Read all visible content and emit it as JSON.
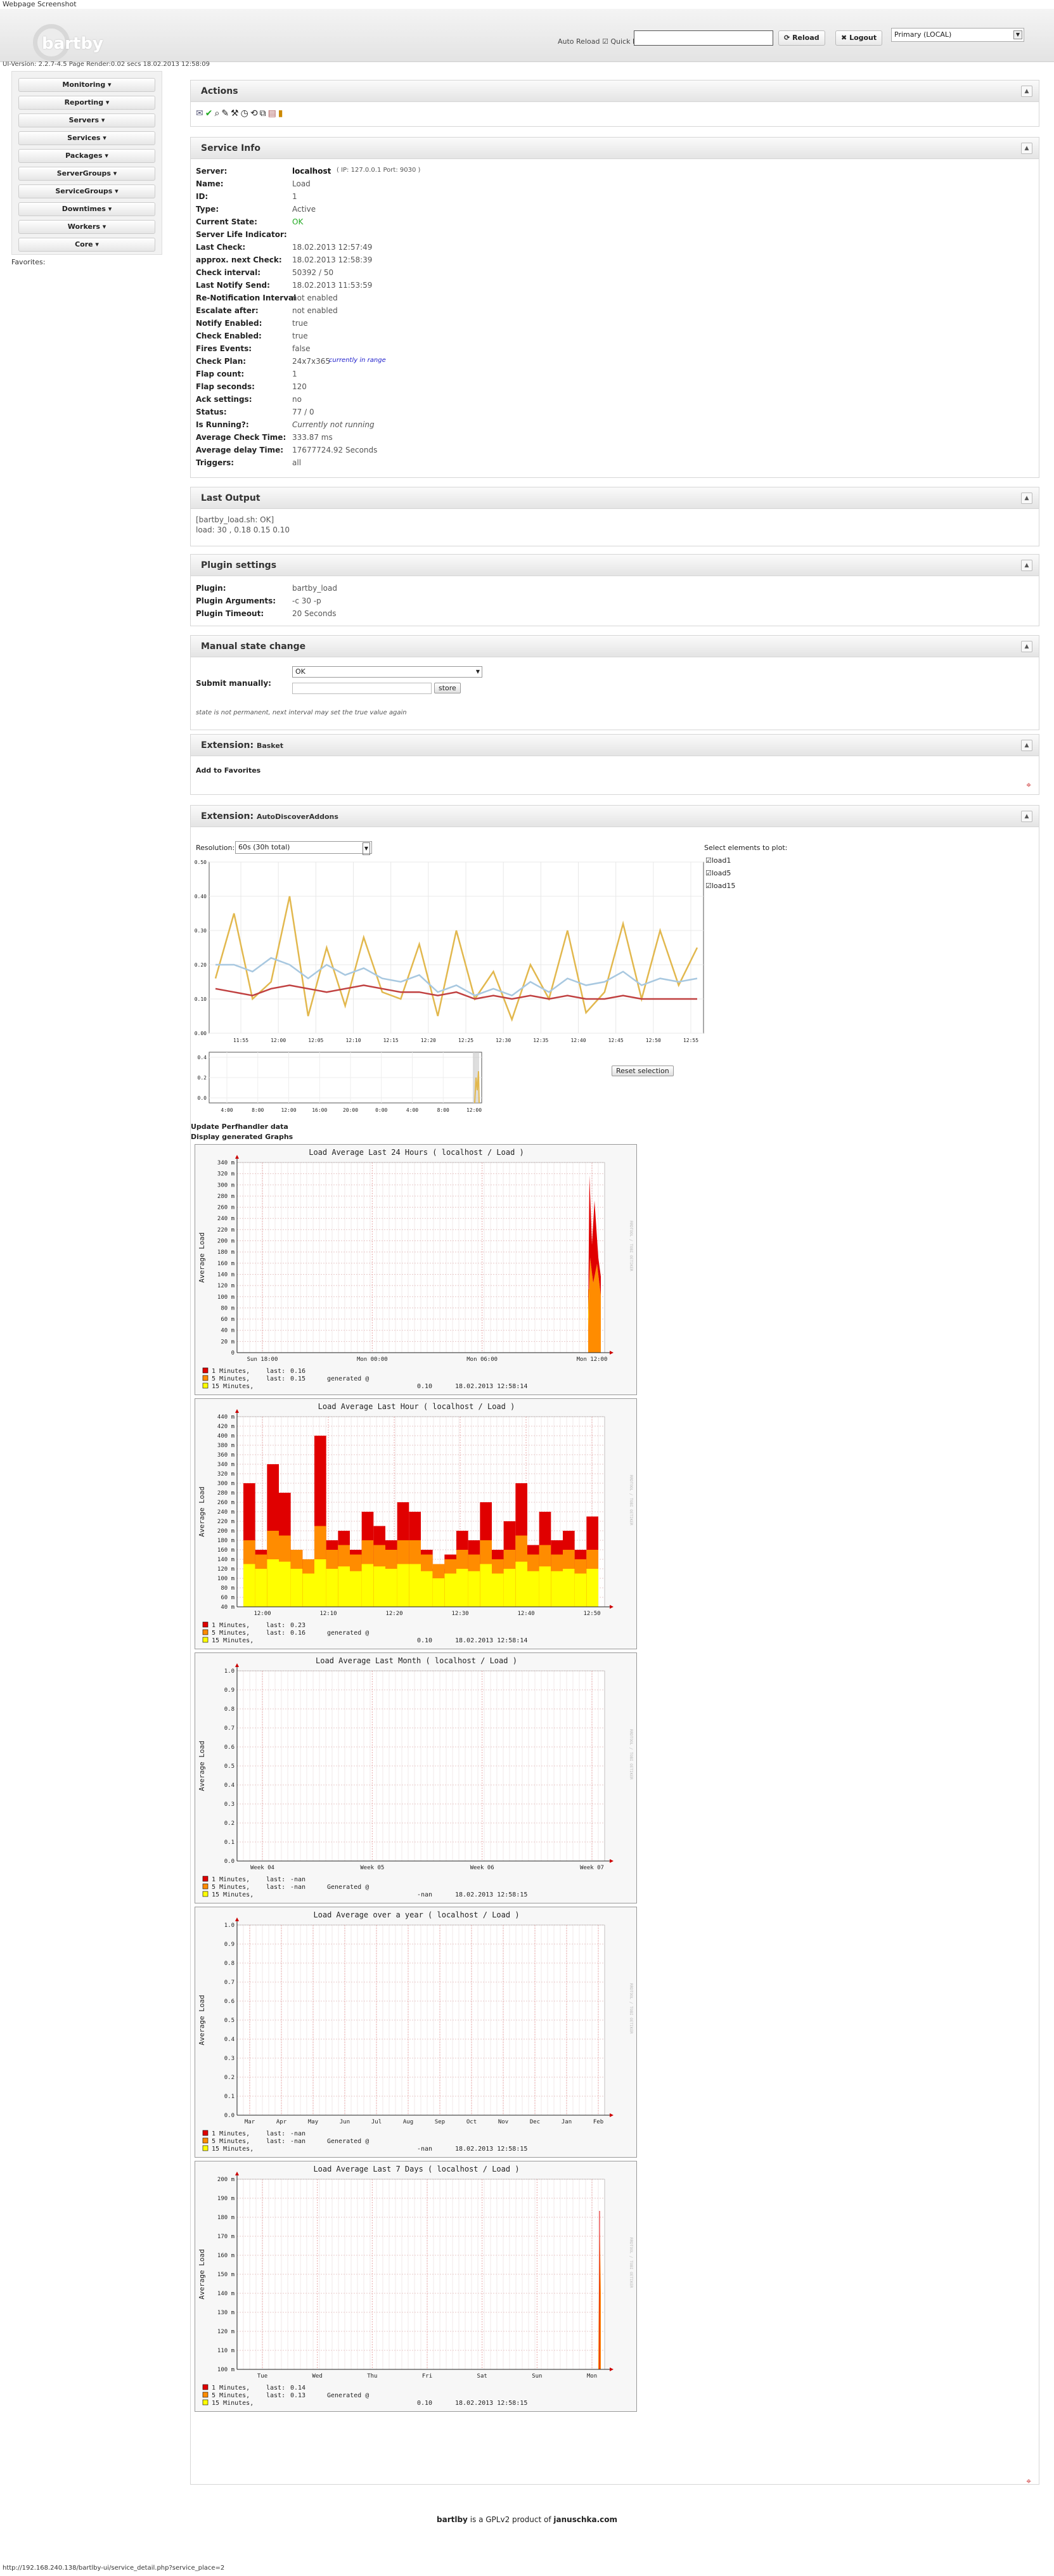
{
  "window_title": "Webpage Screenshot",
  "header": {
    "logo_text": "bartby",
    "auto_reload_label": "Auto Reload",
    "quick_search_label": "Quick Ise",
    "reload_label": "Reload",
    "logout_label": "Logout",
    "server_selected": "Primary (LOCAL)"
  },
  "version_line": "UI-Version: 2.2.7-4.5 Page Render:0.02 secs      18.02.2013 12:58:09",
  "nav": {
    "items": [
      "Monitoring",
      "Reporting",
      "Servers",
      "Services",
      "Packages",
      "ServerGroups",
      "ServiceGroups",
      "Downtimes",
      "Workers",
      "Core"
    ],
    "favorites_label": "Favorites:"
  },
  "actions": {
    "title": "Actions"
  },
  "service_info": {
    "title": "Service Info",
    "rows": [
      {
        "k": "Server:",
        "v": "localhost",
        "extra": "( IP: 127.0.0.1 Port: 9030 )"
      },
      {
        "k": "Name:",
        "v": "Load"
      },
      {
        "k": "ID:",
        "v": "1"
      },
      {
        "k": "Type:",
        "v": "Active"
      },
      {
        "k": "Current State:",
        "v": "OK"
      },
      {
        "k": "Server Life Indicator:",
        "v": ""
      },
      {
        "k": "Last Check:",
        "v": "18.02.2013 12:57:49"
      },
      {
        "k": "approx. next Check:",
        "v": "18.02.2013 12:58:39"
      },
      {
        "k": "Check interval:",
        "v": "50392 / 50"
      },
      {
        "k": "Last Notify Send:",
        "v": "18.02.2013 11:53:59"
      },
      {
        "k": "Re-Notification Interval",
        "v": "not enabled"
      },
      {
        "k": "Escalate after:",
        "v": "not enabled"
      },
      {
        "k": "Notify Enabled:",
        "v": "true"
      },
      {
        "k": "Check Enabled:",
        "v": "true"
      },
      {
        "k": "Fires Events:",
        "v": "false"
      },
      {
        "k": "Check Plan:",
        "v": "24x7x365",
        "extra": "currently in range"
      },
      {
        "k": "Flap count:",
        "v": "1"
      },
      {
        "k": "Flap seconds:",
        "v": "120"
      },
      {
        "k": "Ack settings:",
        "v": "no"
      },
      {
        "k": "Status:",
        "v": "77 / 0"
      },
      {
        "k": "Is Running?:",
        "v": "Currently not running"
      },
      {
        "k": "Average Check Time:",
        "v": "333.87 ms"
      },
      {
        "k": "Average delay Time:",
        "v": "17677724.92 Seconds"
      },
      {
        "k": "Triggers:",
        "v": "all"
      }
    ]
  },
  "last_output": {
    "title": "Last Output",
    "line1": "[bartby_load.sh: OK]",
    "line2": "load: 30 , 0.18 0.15 0.10"
  },
  "plugin_settings": {
    "title": "Plugin settings",
    "rows": [
      {
        "k": "Plugin:",
        "v": "bartby_load"
      },
      {
        "k": "Plugin Arguments:",
        "v": "-c 30 -p"
      },
      {
        "k": "Plugin Timeout:",
        "v": "20 Seconds"
      }
    ]
  },
  "manual_state": {
    "title": "Manual state change",
    "label": "Submit manually:",
    "state_value": "OK",
    "store_label": "store",
    "note": "state is not permanent, next interval may set the true value again"
  },
  "extension_basket": {
    "title_prefix": "Extension:",
    "title_name": "Basket",
    "add_label": "Add to Favorites"
  },
  "extension_autodiscover": {
    "title_prefix": "Extension:",
    "title_name": "AutoDiscoverAddons",
    "resolution_label": "Resolution:",
    "resolution_value": "60s (30h total)",
    "select_label": "Select elements to plot:",
    "elements": [
      "load1",
      "load5",
      "load15"
    ],
    "reset_label": "Reset selection",
    "update_label": "Update Perfhandler data",
    "display_label": "Display generated Graphs"
  },
  "chart_data": [
    {
      "type": "line",
      "x": [
        "11:55",
        "12:00",
        "12:05",
        "12:10",
        "12:15",
        "12:20",
        "12:25",
        "12:30",
        "12:35",
        "12:40",
        "12:45",
        "12:50",
        "12:55"
      ],
      "y_ticks": [
        "0.00",
        "0.10",
        "0.20",
        "0.30",
        "0.40",
        "0.50"
      ],
      "ylim": [
        0,
        0.5
      ],
      "series": [
        {
          "name": "load1",
          "color": "#e2b84e",
          "values": [
            0.16,
            0.35,
            0.1,
            0.15,
            0.4,
            0.05,
            0.25,
            0.08,
            0.28,
            0.12,
            0.1,
            0.26,
            0.05,
            0.3,
            0.1,
            0.18,
            0.04,
            0.2,
            0.1,
            0.3,
            0.06,
            0.12,
            0.32,
            0.1,
            0.3,
            0.14,
            0.25
          ]
        },
        {
          "name": "load5",
          "color": "#a8c8e0",
          "values": [
            0.2,
            0.2,
            0.18,
            0.22,
            0.2,
            0.16,
            0.2,
            0.17,
            0.19,
            0.16,
            0.15,
            0.17,
            0.12,
            0.14,
            0.11,
            0.13,
            0.11,
            0.15,
            0.12,
            0.16,
            0.14,
            0.15,
            0.18,
            0.14,
            0.16,
            0.15,
            0.16
          ]
        },
        {
          "name": "load15",
          "color": "#c04040",
          "values": [
            0.13,
            0.12,
            0.11,
            0.13,
            0.14,
            0.13,
            0.12,
            0.13,
            0.14,
            0.13,
            0.12,
            0.12,
            0.11,
            0.12,
            0.1,
            0.11,
            0.1,
            0.11,
            0.1,
            0.11,
            0.1,
            0.1,
            0.11,
            0.1,
            0.1,
            0.1,
            0.1
          ]
        }
      ],
      "overview_x": [
        "4:00",
        "8:00",
        "12:00",
        "16:00",
        "20:00",
        "0:00",
        "4:00",
        "8:00",
        "12:00"
      ],
      "overview_y": [
        "0.4",
        "0.2",
        "0.0"
      ]
    },
    {
      "type": "bar",
      "title": "Load Average Last 24 Hours ( localhost / Load )",
      "ylabel": "Average Load",
      "y_ticks": [
        "0",
        "20 m",
        "40 m",
        "60 m",
        "80 m",
        "100 m",
        "120 m",
        "140 m",
        "160 m",
        "180 m",
        "200 m",
        "220 m",
        "240 m",
        "260 m",
        "280 m",
        "300 m",
        "320 m",
        "340 m"
      ],
      "x_ticks": [
        "Sun 18:00",
        "Mon 00:00",
        "Mon 06:00",
        "Mon 12:00"
      ],
      "legend": [
        {
          "name": "1 Minutes,",
          "last": "0.16",
          "color": "#e00000"
        },
        {
          "name": "5 Minutes,",
          "last": "0.15",
          "color": "#ff8c00"
        },
        {
          "name": "15 Minutes,",
          "last": "",
          "color": "#ffff00"
        }
      ],
      "footer_value": "0.10",
      "generated": "generated @",
      "timestamp": "18.02.2013 12:58:14"
    },
    {
      "type": "bar",
      "title": "Load Average Last Hour ( localhost / Load )",
      "ylabel": "Average Load",
      "y_ticks": [
        "40 m",
        "60 m",
        "80 m",
        "100 m",
        "120 m",
        "140 m",
        "160 m",
        "180 m",
        "200 m",
        "220 m",
        "240 m",
        "260 m",
        "280 m",
        "300 m",
        "320 m",
        "340 m",
        "360 m",
        "380 m",
        "400 m",
        "420 m",
        "440 m"
      ],
      "x_ticks": [
        "12:00",
        "12:10",
        "12:20",
        "12:30",
        "12:40",
        "12:50"
      ],
      "values_1m": [
        300,
        160,
        340,
        280,
        160,
        140,
        400,
        180,
        200,
        160,
        240,
        210,
        180,
        260,
        240,
        160,
        120,
        150,
        200,
        180,
        260,
        160,
        220,
        300,
        170,
        240,
        180,
        200,
        160,
        230
      ],
      "values_5m": [
        180,
        150,
        200,
        190,
        160,
        140,
        210,
        160,
        170,
        150,
        180,
        170,
        160,
        180,
        180,
        150,
        130,
        140,
        160,
        150,
        180,
        140,
        160,
        190,
        150,
        170,
        150,
        160,
        140,
        160
      ],
      "values_15m": [
        130,
        120,
        140,
        135,
        120,
        110,
        140,
        120,
        125,
        115,
        130,
        125,
        120,
        130,
        130,
        115,
        100,
        110,
        120,
        115,
        130,
        110,
        120,
        135,
        115,
        125,
        115,
        120,
        110,
        120
      ],
      "legend": [
        {
          "name": "1 Minutes,",
          "last": "0.23",
          "color": "#e00000"
        },
        {
          "name": "5 Minutes,",
          "last": "0.16",
          "color": "#ff8c00"
        },
        {
          "name": "15 Minutes,",
          "last": "",
          "color": "#ffff00"
        }
      ],
      "footer_value": "0.10",
      "generated": "generated @",
      "timestamp": "18.02.2013 12:58:14"
    },
    {
      "type": "line",
      "title": "Load Average Last Month ( localhost / Load )",
      "ylabel": "Average Load",
      "y_ticks": [
        "0.0",
        "0.1",
        "0.2",
        "0.3",
        "0.4",
        "0.5",
        "0.6",
        "0.7",
        "0.8",
        "0.9",
        "1.0"
      ],
      "x_ticks": [
        "Week 04",
        "Week 05",
        "Week 06",
        "Week 07"
      ],
      "legend": [
        {
          "name": "1 Minutes,",
          "last": "-nan",
          "color": "#e00000"
        },
        {
          "name": "5 Minutes,",
          "last": "-nan",
          "color": "#ff8c00"
        },
        {
          "name": "15 Minutes,",
          "last": "",
          "color": "#ffff00"
        }
      ],
      "footer_value": "-nan",
      "generated": "Generated @",
      "timestamp": "18.02.2013 12:58:15"
    },
    {
      "type": "line",
      "title": "Load Average over a year ( localhost / Load )",
      "ylabel": "Average Load",
      "y_ticks": [
        "0.0",
        "0.1",
        "0.2",
        "0.3",
        "0.4",
        "0.5",
        "0.6",
        "0.7",
        "0.8",
        "0.9",
        "1.0"
      ],
      "x_ticks": [
        "Mar",
        "Apr",
        "May",
        "Jun",
        "Jul",
        "Aug",
        "Sep",
        "Oct",
        "Nov",
        "Dec",
        "Jan",
        "Feb"
      ],
      "legend": [
        {
          "name": "1 Minutes,",
          "last": "-nan",
          "color": "#e00000"
        },
        {
          "name": "5 Minutes,",
          "last": "-nan",
          "color": "#ff8c00"
        },
        {
          "name": "15 Minutes,",
          "last": "",
          "color": "#ffff00"
        }
      ],
      "footer_value": "-nan",
      "generated": "Generated @",
      "timestamp": "18.02.2013 12:58:15"
    },
    {
      "type": "bar",
      "title": "Load Average Last 7 Days ( localhost / Load )",
      "ylabel": "Average Load",
      "y_ticks": [
        "100 m",
        "110 m",
        "120 m",
        "130 m",
        "140 m",
        "150 m",
        "160 m",
        "170 m",
        "180 m",
        "190 m",
        "200 m"
      ],
      "x_ticks": [
        "Tue",
        "Wed",
        "Thu",
        "Fri",
        "Sat",
        "Sun",
        "Mon"
      ],
      "legend": [
        {
          "name": "1 Minutes,",
          "last": "0.14",
          "color": "#e00000"
        },
        {
          "name": "5 Minutes,",
          "last": "0.13",
          "color": "#ff8c00"
        },
        {
          "name": "15 Minutes,",
          "last": "",
          "color": "#ffff00"
        }
      ],
      "footer_value": "0.10",
      "generated": "Generated @",
      "timestamp": "18.02.2013 12:58:15"
    }
  ],
  "footer": {
    "brand": "bartlby",
    "middle": " is a GPLv2 product of ",
    "author": "januschka.com"
  },
  "status_url": "http://192.168.240.138/bartlby-ui/service_detail.php?service_place=2"
}
